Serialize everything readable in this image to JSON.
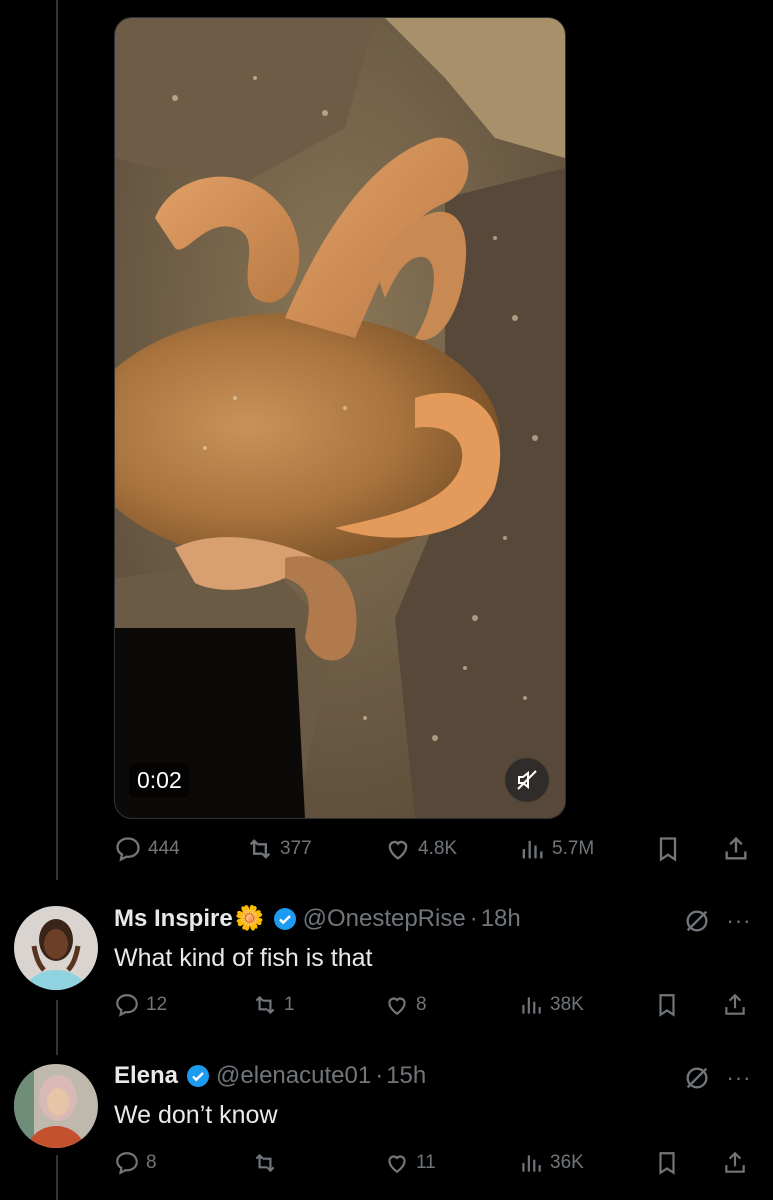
{
  "post": {
    "video": {
      "timestamp": "0:02",
      "muted": true
    },
    "actions": {
      "replies": "444",
      "reposts": "377",
      "likes": "4.8K",
      "views": "5.7M"
    }
  },
  "replies": [
    {
      "name": "Ms Inspire",
      "emoji": "🌼",
      "verified": true,
      "handle": "@OnestepRise",
      "time": "18h",
      "text": "What kind of fish is that",
      "actions": {
        "replies": "12",
        "reposts": "1",
        "likes": "8",
        "views": "38K"
      }
    },
    {
      "name": "Elena",
      "verified": true,
      "handle": "@elenacute01",
      "time": "15h",
      "text": "We don’t know",
      "actions": {
        "replies": "8",
        "reposts": "",
        "likes": "11",
        "views": "36K"
      }
    }
  ],
  "colors": {
    "background": "#000000",
    "text_primary": "#e7e9ea",
    "text_secondary": "#71767b",
    "verified_blue": "#1d9bf0"
  }
}
